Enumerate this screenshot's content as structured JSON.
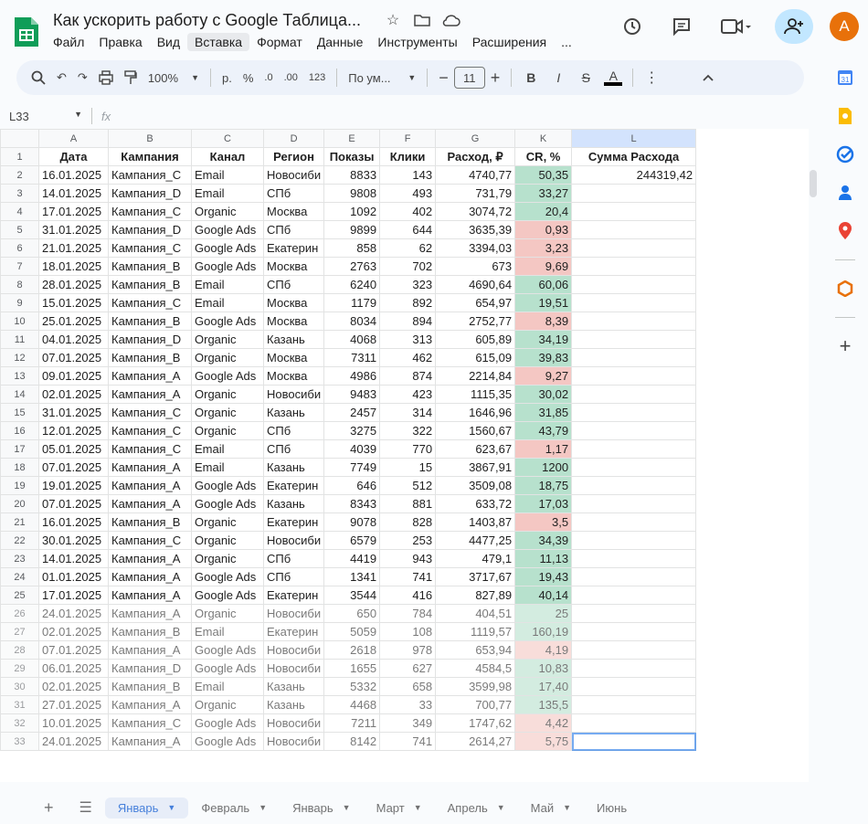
{
  "doc": {
    "title": "Как ускорить работу с Google Таблица...",
    "menu": [
      "Файл",
      "Правка",
      "Вид",
      "Вставка",
      "Формат",
      "Данные",
      "Инструменты",
      "Расширения",
      "..."
    ],
    "avatar_letter": "A"
  },
  "toolbar": {
    "zoom": "100%",
    "currency": "р.",
    "percent": "%",
    "dec_less": ".0",
    "dec_more": ".00",
    "number_format": "123",
    "font": "По ум...",
    "font_size": "11",
    "bold": "B",
    "italic": "I",
    "strike": "S",
    "text_color": "A"
  },
  "formula_bar": {
    "cell_ref": "L33",
    "fx": "fx"
  },
  "columns": [
    "A",
    "B",
    "C",
    "D",
    "E",
    "F",
    "G",
    "K",
    "L"
  ],
  "headers": [
    "Дата",
    "Кампания",
    "Канал",
    "Регион",
    "Показы",
    "Клики",
    "Расход, ₽",
    "CR, %",
    "Сумма Расхода"
  ],
  "sum_value": "244319,42",
  "rows": [
    {
      "n": "2",
      "a": "16.01.2025",
      "b": "Кампания_C",
      "c": "Email",
      "d": "Новосиби",
      "e": "8833",
      "f": "143",
      "g": "4740,77",
      "k": "50,35",
      "cr": "green"
    },
    {
      "n": "3",
      "a": "14.01.2025",
      "b": "Кампания_D",
      "c": "Email",
      "d": "СПб",
      "e": "9808",
      "f": "493",
      "g": "731,79",
      "k": "33,27",
      "cr": "green"
    },
    {
      "n": "4",
      "a": "17.01.2025",
      "b": "Кампания_C",
      "c": "Organic",
      "d": "Москва",
      "e": "1092",
      "f": "402",
      "g": "3074,72",
      "k": "20,4",
      "cr": "green"
    },
    {
      "n": "5",
      "a": "31.01.2025",
      "b": "Кампания_D",
      "c": "Google Ads",
      "d": "СПб",
      "e": "9899",
      "f": "644",
      "g": "3635,39",
      "k": "0,93",
      "cr": "red"
    },
    {
      "n": "6",
      "a": "21.01.2025",
      "b": "Кампания_C",
      "c": "Google Ads",
      "d": "Екатерин",
      "e": "858",
      "f": "62",
      "g": "3394,03",
      "k": "3,23",
      "cr": "red"
    },
    {
      "n": "7",
      "a": "18.01.2025",
      "b": "Кампания_B",
      "c": "Google Ads",
      "d": "Москва",
      "e": "2763",
      "f": "702",
      "g": "673",
      "k": "9,69",
      "cr": "red"
    },
    {
      "n": "8",
      "a": "28.01.2025",
      "b": "Кампания_B",
      "c": "Email",
      "d": "СПб",
      "e": "6240",
      "f": "323",
      "g": "4690,64",
      "k": "60,06",
      "cr": "green"
    },
    {
      "n": "9",
      "a": "15.01.2025",
      "b": "Кампания_C",
      "c": "Email",
      "d": "Москва",
      "e": "1179",
      "f": "892",
      "g": "654,97",
      "k": "19,51",
      "cr": "green"
    },
    {
      "n": "10",
      "a": "25.01.2025",
      "b": "Кампания_B",
      "c": "Google Ads",
      "d": "Москва",
      "e": "8034",
      "f": "894",
      "g": "2752,77",
      "k": "8,39",
      "cr": "red"
    },
    {
      "n": "11",
      "a": "04.01.2025",
      "b": "Кампания_D",
      "c": "Organic",
      "d": "Казань",
      "e": "4068",
      "f": "313",
      "g": "605,89",
      "k": "34,19",
      "cr": "green"
    },
    {
      "n": "12",
      "a": "07.01.2025",
      "b": "Кампания_B",
      "c": "Organic",
      "d": "Москва",
      "e": "7311",
      "f": "462",
      "g": "615,09",
      "k": "39,83",
      "cr": "green"
    },
    {
      "n": "13",
      "a": "09.01.2025",
      "b": "Кампания_A",
      "c": "Google Ads",
      "d": "Москва",
      "e": "4986",
      "f": "874",
      "g": "2214,84",
      "k": "9,27",
      "cr": "red"
    },
    {
      "n": "14",
      "a": "02.01.2025",
      "b": "Кампания_A",
      "c": "Organic",
      "d": "Новосиби",
      "e": "9483",
      "f": "423",
      "g": "1115,35",
      "k": "30,02",
      "cr": "green"
    },
    {
      "n": "15",
      "a": "31.01.2025",
      "b": "Кампания_C",
      "c": "Organic",
      "d": "Казань",
      "e": "2457",
      "f": "314",
      "g": "1646,96",
      "k": "31,85",
      "cr": "green"
    },
    {
      "n": "16",
      "a": "12.01.2025",
      "b": "Кампания_C",
      "c": "Organic",
      "d": "СПб",
      "e": "3275",
      "f": "322",
      "g": "1560,67",
      "k": "43,79",
      "cr": "green"
    },
    {
      "n": "17",
      "a": "05.01.2025",
      "b": "Кампания_C",
      "c": "Email",
      "d": "СПб",
      "e": "4039",
      "f": "770",
      "g": "623,67",
      "k": "1,17",
      "cr": "red"
    },
    {
      "n": "18",
      "a": "07.01.2025",
      "b": "Кампания_A",
      "c": "Email",
      "d": "Казань",
      "e": "7749",
      "f": "15",
      "g": "3867,91",
      "k": "1200",
      "cr": "green"
    },
    {
      "n": "19",
      "a": "19.01.2025",
      "b": "Кампания_A",
      "c": "Google Ads",
      "d": "Екатерин",
      "e": "646",
      "f": "512",
      "g": "3509,08",
      "k": "18,75",
      "cr": "green"
    },
    {
      "n": "20",
      "a": "07.01.2025",
      "b": "Кампания_A",
      "c": "Google Ads",
      "d": "Казань",
      "e": "8343",
      "f": "881",
      "g": "633,72",
      "k": "17,03",
      "cr": "green"
    },
    {
      "n": "21",
      "a": "16.01.2025",
      "b": "Кампания_B",
      "c": "Organic",
      "d": "Екатерин",
      "e": "9078",
      "f": "828",
      "g": "1403,87",
      "k": "3,5",
      "cr": "red"
    },
    {
      "n": "22",
      "a": "30.01.2025",
      "b": "Кампания_C",
      "c": "Organic",
      "d": "Новосиби",
      "e": "6579",
      "f": "253",
      "g": "4477,25",
      "k": "34,39",
      "cr": "green"
    },
    {
      "n": "23",
      "a": "14.01.2025",
      "b": "Кампания_A",
      "c": "Organic",
      "d": "СПб",
      "e": "4419",
      "f": "943",
      "g": "479,1",
      "k": "11,13",
      "cr": "green"
    },
    {
      "n": "24",
      "a": "01.01.2025",
      "b": "Кампания_A",
      "c": "Google Ads",
      "d": "СПб",
      "e": "1341",
      "f": "741",
      "g": "3717,67",
      "k": "19,43",
      "cr": "green"
    },
    {
      "n": "25",
      "a": "17.01.2025",
      "b": "Кампания_A",
      "c": "Google Ads",
      "d": "Екатерин",
      "e": "3544",
      "f": "416",
      "g": "827,89",
      "k": "40,14",
      "cr": "green"
    },
    {
      "n": "26",
      "a": "24.01.2025",
      "b": "Кампания_A",
      "c": "Organic",
      "d": "Новосиби",
      "e": "650",
      "f": "784",
      "g": "404,51",
      "k": "25",
      "cr": "green"
    },
    {
      "n": "27",
      "a": "02.01.2025",
      "b": "Кампания_B",
      "c": "Email",
      "d": "Екатерин",
      "e": "5059",
      "f": "108",
      "g": "1119,57",
      "k": "160,19",
      "cr": "green"
    },
    {
      "n": "28",
      "a": "07.01.2025",
      "b": "Кампания_A",
      "c": "Google Ads",
      "d": "Новосиби",
      "e": "2618",
      "f": "978",
      "g": "653,94",
      "k": "4,19",
      "cr": "red"
    },
    {
      "n": "29",
      "a": "06.01.2025",
      "b": "Кампания_D",
      "c": "Google Ads",
      "d": "Новосиби",
      "e": "1655",
      "f": "627",
      "g": "4584,5",
      "k": "10,83",
      "cr": "green"
    },
    {
      "n": "30",
      "a": "02.01.2025",
      "b": "Кампания_B",
      "c": "Email",
      "d": "Казань",
      "e": "5332",
      "f": "658",
      "g": "3599,98",
      "k": "17,40",
      "cr": "green"
    },
    {
      "n": "31",
      "a": "27.01.2025",
      "b": "Кампания_A",
      "c": "Organic",
      "d": "Казань",
      "e": "4468",
      "f": "33",
      "g": "700,77",
      "k": "135,5",
      "cr": "green"
    },
    {
      "n": "32",
      "a": "10.01.2025",
      "b": "Кампания_C",
      "c": "Google Ads",
      "d": "Новосиби",
      "e": "7211",
      "f": "349",
      "g": "1747,62",
      "k": "4,42",
      "cr": "red"
    },
    {
      "n": "33",
      "a": "24.01.2025",
      "b": "Кампания_A",
      "c": "Google Ads",
      "d": "Новосиби",
      "e": "8142",
      "f": "741",
      "g": "2614,27",
      "k": "5,75",
      "cr": "red"
    }
  ],
  "sheet_tabs": [
    "Январь",
    "Февраль",
    "Январь",
    "Март",
    "Апрель",
    "Май",
    "Июнь"
  ],
  "colors": {
    "accent": "#1a73e8",
    "cr_good": "#b7e1cd",
    "cr_bad": "#f4c7c3"
  }
}
